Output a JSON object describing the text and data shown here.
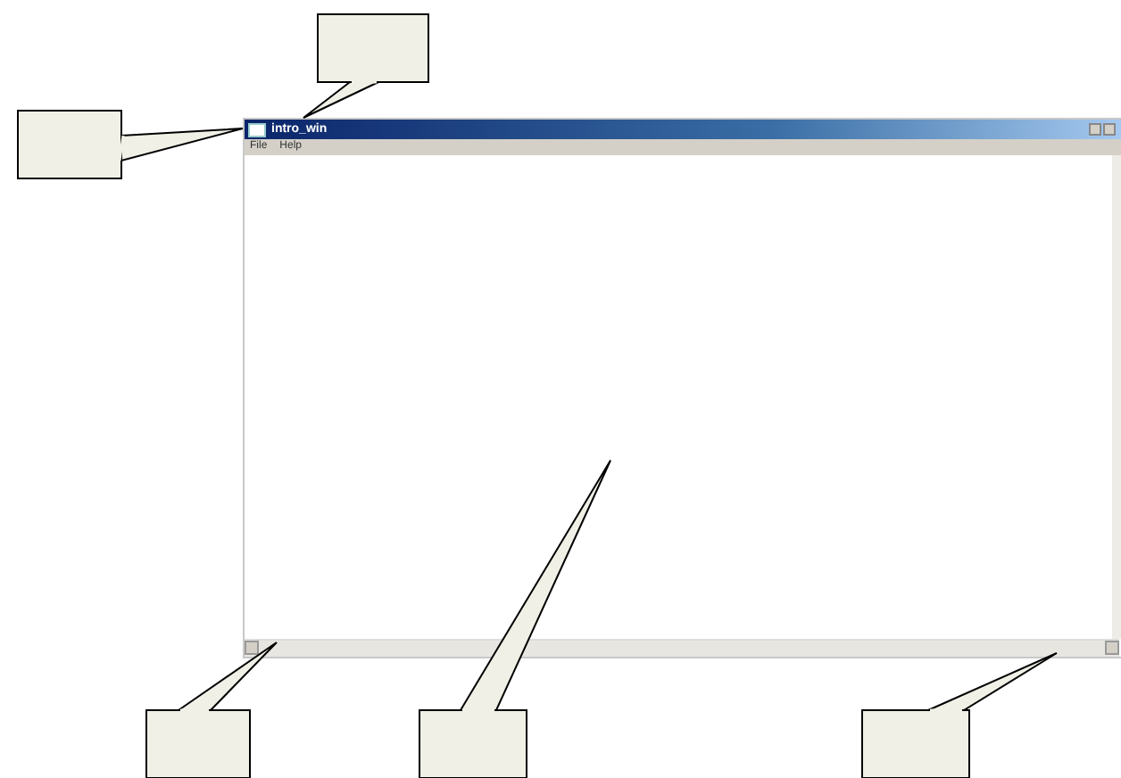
{
  "window": {
    "title": "intro_win"
  },
  "menu": [
    {
      "label": "File"
    },
    {
      "label": "Help"
    }
  ]
}
